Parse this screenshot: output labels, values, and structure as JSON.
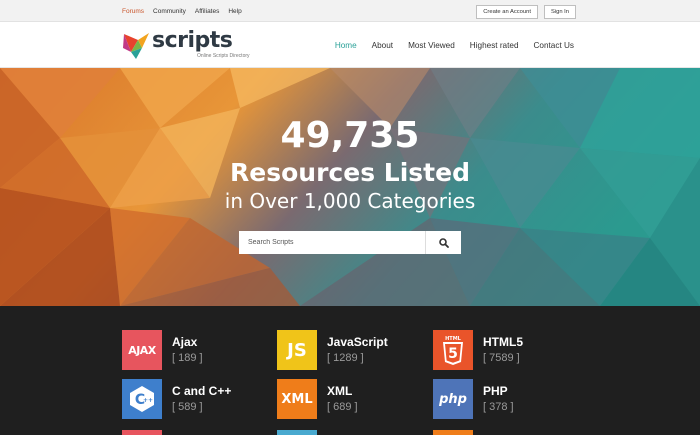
{
  "topbar": {
    "links": [
      "Forums",
      "Community",
      "Affiliates",
      "Help"
    ],
    "active": "Forums",
    "create_account": "Create an Account",
    "sign_in": "Sign In"
  },
  "brand": {
    "name": "scripts",
    "tagline": "Online Scripts Directory"
  },
  "nav": [
    "Home",
    "About",
    "Most Viewed",
    "Highest rated",
    "Contact Us"
  ],
  "hero": {
    "count": "49,735",
    "line1": "Resources Listed",
    "line2": "in Over 1,000 Categories"
  },
  "search": {
    "placeholder": "Search Scripts",
    "icon": "search-icon"
  },
  "categories": [
    {
      "name": "Ajax",
      "count": "[ 189 ]",
      "icon": "ajax-icon",
      "color": "#e7555e"
    },
    {
      "name": "JavaScript",
      "count": "[ 1289 ]",
      "icon": "js-icon",
      "color": "#f0c419"
    },
    {
      "name": "HTML5",
      "count": "[ 7589 ]",
      "icon": "html5-icon",
      "color": "#e9542a"
    },
    {
      "name": "C and C++",
      "count": "[ 589 ]",
      "icon": "cpp-icon",
      "color": "#3e7fcc"
    },
    {
      "name": "XML",
      "count": "[ 689 ]",
      "icon": "xml-icon",
      "color": "#ef7d1a"
    },
    {
      "name": "PHP",
      "count": "[ 378 ]",
      "icon": "php-icon",
      "color": "#4e74b8"
    }
  ],
  "colors": {
    "accent": "#2aa198",
    "topbar_active": "#c9552b",
    "footer_bg": "#1f1f1f"
  }
}
